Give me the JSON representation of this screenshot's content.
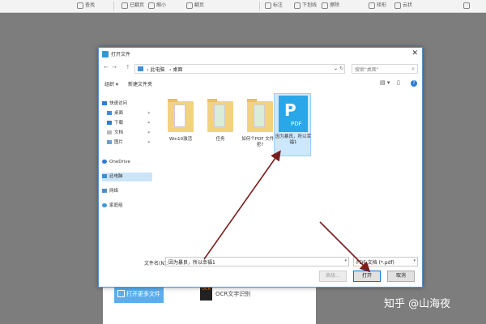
{
  "toolbar": {
    "items": [
      "查找",
      "已翻页",
      "缩小",
      "翻页",
      "标注",
      "下划线",
      "擦除",
      "矩形",
      "云状"
    ]
  },
  "host": {
    "open_more_label": "打开更多文件",
    "ocr_icon_text": "OCR",
    "ocr_label": "OCR文字识别"
  },
  "dialog": {
    "title": "打开文件",
    "close_glyph": "✕",
    "nav": {
      "back": "←",
      "forward": "→",
      "up": "↑"
    },
    "path": [
      "此电脑",
      "桌面"
    ],
    "search_placeholder": "搜索\"桌面\"",
    "refresh_glyph": "↻",
    "organize_label": "组织 ▾",
    "new_folder_label": "新建文件夹",
    "help_glyph": "?",
    "view_glyph": "▤ ▾",
    "nav_items": [
      {
        "label": "快速访问",
        "pinned": false
      },
      {
        "label": "桌面",
        "pinned": true
      },
      {
        "label": "下载",
        "pinned": true
      },
      {
        "label": "文档",
        "pinned": true
      },
      {
        "label": "图片",
        "pinned": true
      },
      {
        "label": "OneDrive",
        "pinned": false
      },
      {
        "label": "此电脑",
        "pinned": false
      },
      {
        "label": "网络",
        "pinned": false
      },
      {
        "label": "家庭组",
        "pinned": false
      }
    ],
    "files": [
      {
        "label": "Win10激活",
        "type": "folder"
      },
      {
        "label": "任务",
        "type": "folder"
      },
      {
        "label": "如何个PDF 文件加密?",
        "type": "folder"
      },
      {
        "label": "因为暴良，所以幸福1",
        "type": "pdf",
        "selected": true
      }
    ],
    "pdf_icon_text": "PDF",
    "filename_label": "文件名(N):",
    "filename_value": "因为暴良，所以幸福1",
    "filetype_value": "PDF 文档 (*.pdf)",
    "buttons": {
      "advanced": "高级...",
      "open": "打开",
      "cancel": "取消"
    }
  },
  "watermark": "知乎 @山海夜"
}
